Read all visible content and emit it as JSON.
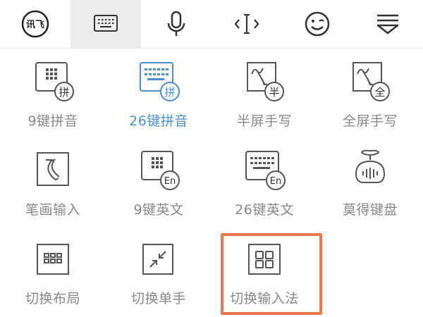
{
  "toolbar": {
    "buttons": [
      {
        "id": "logo",
        "icon": "xunfei-logo-icon",
        "label": "讯飞"
      },
      {
        "id": "keyboard",
        "icon": "keyboard-icon",
        "active": true
      },
      {
        "id": "voice",
        "icon": "microphone-icon"
      },
      {
        "id": "cursor",
        "icon": "cursor-move-icon"
      },
      {
        "id": "emoji",
        "icon": "wink-face-icon"
      },
      {
        "id": "collapse",
        "icon": "collapse-down-icon"
      }
    ]
  },
  "grid": {
    "items": [
      {
        "label": "9键拼音",
        "badge": "拼",
        "icon": "keypad-9-pinyin-icon"
      },
      {
        "label": "26键拼音",
        "badge": "拼",
        "icon": "keyboard-26-pinyin-icon",
        "selected": true
      },
      {
        "label": "半屏手写",
        "badge": "半",
        "icon": "half-screen-handwriting-icon"
      },
      {
        "label": "全屏手写",
        "badge": "全",
        "icon": "full-screen-handwriting-icon"
      },
      {
        "label": "笔画输入",
        "icon": "stroke-input-icon"
      },
      {
        "label": "9键英文",
        "badge": "En",
        "icon": "keypad-9-english-icon"
      },
      {
        "label": "26键英文",
        "badge": "En",
        "icon": "keyboard-26-english-icon"
      },
      {
        "label": "莫得键盘",
        "icon": "robot-keyboard-icon"
      },
      {
        "label": "切换布局",
        "icon": "switch-layout-icon"
      },
      {
        "label": "切换单手",
        "icon": "one-handed-icon"
      },
      {
        "label": "切换输入法",
        "icon": "switch-input-method-icon",
        "highlighted": true
      }
    ]
  },
  "colors": {
    "selected_text": "#4a90d9",
    "label_text": "#888888",
    "highlight_border": "#ec7a4d",
    "icon_stroke": "#555555"
  }
}
